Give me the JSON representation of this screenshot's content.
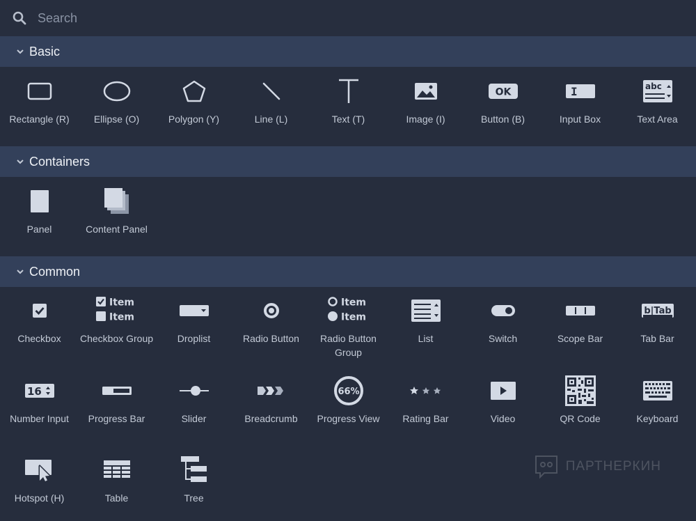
{
  "search": {
    "placeholder": "Search"
  },
  "sections": [
    {
      "title": "Basic",
      "items": [
        {
          "label": "Rectangle (R)",
          "icon": "rectangle-icon"
        },
        {
          "label": "Ellipse (O)",
          "icon": "ellipse-icon"
        },
        {
          "label": "Polygon (Y)",
          "icon": "polygon-icon"
        },
        {
          "label": "Line (L)",
          "icon": "line-icon"
        },
        {
          "label": "Text (T)",
          "icon": "text-icon"
        },
        {
          "label": "Image (I)",
          "icon": "image-icon"
        },
        {
          "label": "Button (B)",
          "icon": "button-icon"
        },
        {
          "label": "Input Box",
          "icon": "input-box-icon"
        },
        {
          "label": "Text Area",
          "icon": "text-area-icon"
        }
      ]
    },
    {
      "title": "Containers",
      "items": [
        {
          "label": "Panel",
          "icon": "panel-icon"
        },
        {
          "label": "Content Panel",
          "icon": "content-panel-icon"
        }
      ]
    },
    {
      "title": "Common",
      "items": [
        {
          "label": "Checkbox",
          "icon": "checkbox-icon"
        },
        {
          "label": "Checkbox Group",
          "icon": "checkbox-group-icon"
        },
        {
          "label": "Droplist",
          "icon": "droplist-icon"
        },
        {
          "label": "Radio Button",
          "icon": "radio-button-icon"
        },
        {
          "label": "Radio Button Group",
          "icon": "radio-button-group-icon"
        },
        {
          "label": "List",
          "icon": "list-icon"
        },
        {
          "label": "Switch",
          "icon": "switch-icon"
        },
        {
          "label": "Scope Bar",
          "icon": "scope-bar-icon"
        },
        {
          "label": "Tab Bar",
          "icon": "tab-bar-icon"
        },
        {
          "label": "Number Input",
          "icon": "number-input-icon"
        },
        {
          "label": "Progress Bar",
          "icon": "progress-bar-icon"
        },
        {
          "label": "Slider",
          "icon": "slider-icon"
        },
        {
          "label": "Breadcrumb",
          "icon": "breadcrumb-icon"
        },
        {
          "label": "Progress View",
          "icon": "progress-view-icon"
        },
        {
          "label": "Rating Bar",
          "icon": "rating-bar-icon"
        },
        {
          "label": "Video",
          "icon": "video-icon"
        },
        {
          "label": "QR Code",
          "icon": "qr-code-icon"
        },
        {
          "label": "Keyboard",
          "icon": "keyboard-icon"
        },
        {
          "label": "Hotspot (H)",
          "icon": "hotspot-icon"
        },
        {
          "label": "Table",
          "icon": "table-icon"
        },
        {
          "label": "Tree",
          "icon": "tree-icon"
        }
      ]
    }
  ],
  "icon_text": {
    "item": "Item",
    "button_ok": "OK",
    "input_cursor": "I",
    "textarea_abc": "abc",
    "tab_bar": "b|Tab",
    "number_value": "16",
    "progress_percent": "66%"
  },
  "watermark": {
    "text": "ПАРТНЕРКИН"
  },
  "colors": {
    "background": "#262d3d",
    "header": "#33405a",
    "icon": "#d3d9e4",
    "label": "#c3cad6"
  }
}
